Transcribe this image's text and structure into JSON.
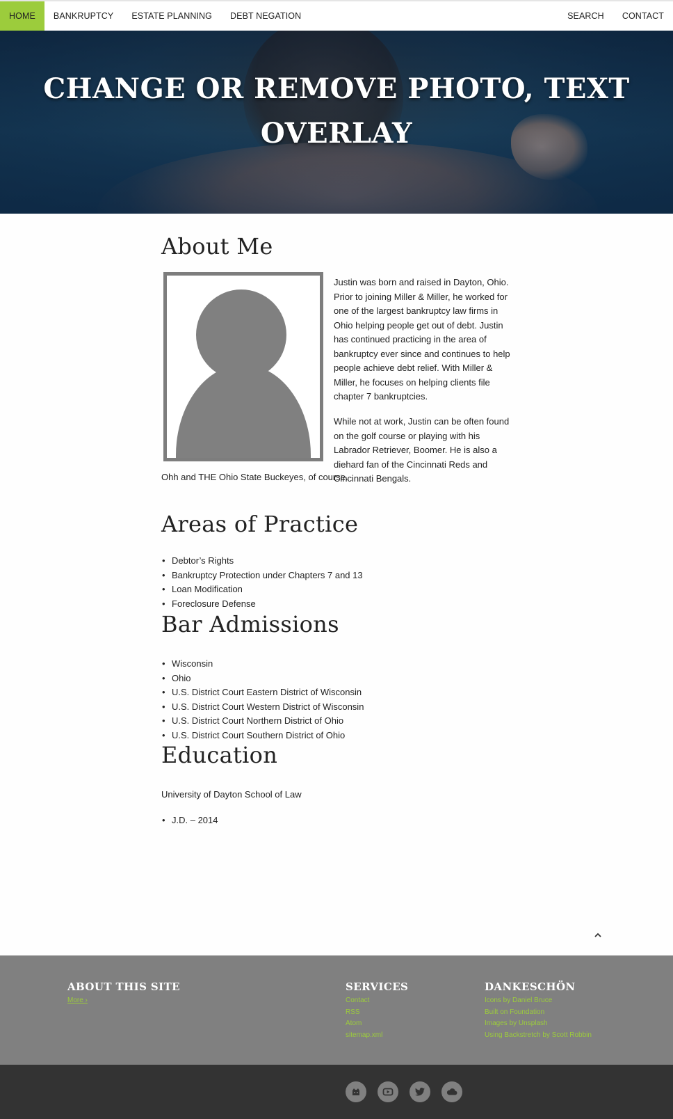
{
  "nav": {
    "left": [
      {
        "label": "HOME",
        "active": true
      },
      {
        "label": "BANKRUPTCY",
        "active": false
      },
      {
        "label": "ESTATE PLANNING",
        "active": false
      },
      {
        "label": "DEBT NEGATION",
        "active": false
      }
    ],
    "right": [
      {
        "label": "SEARCH"
      },
      {
        "label": "CONTACT"
      }
    ]
  },
  "hero": {
    "title": "CHANGE OR REMOVE PHOTO, TEXT OVERLAY"
  },
  "about": {
    "title": "About Me",
    "bio_paragraph_1": "Justin was born and raised in Dayton, Ohio. Prior to joining Miller & Miller, he worked for one of the largest bankruptcy law firms in Ohio helping people get out of debt. Justin has continued practicing in the area of bankruptcy ever since and continues to help people achieve debt relief. With Miller & Miller, he focuses on helping clients file chapter 7 bankruptcies.",
    "bio_paragraph_2": "While not at work, Justin can be often found on the golf course or playing with his Labrador Retriever, Boomer. He is also a diehard fan of the Cincinnati Reds and Cincinnati Bengals.",
    "bio_paragraph_2_tail": "Ohh and THE Ohio State Buckeyes, of course."
  },
  "areas": {
    "title": "Areas of Practice",
    "items": [
      "Debtor’s Rights",
      "Bankruptcy Protection under Chapters 7 and 13",
      "Loan Modification",
      "Foreclosure Defense"
    ]
  },
  "bar": {
    "title": "Bar Admissions",
    "items": [
      "Wisconsin",
      "Ohio",
      "U.S. District Court Eastern District of Wisconsin",
      "U.S. District Court Western District of Wisconsin",
      "U.S. District Court Northern District of Ohio",
      "U.S. District Court Southern District of Ohio"
    ]
  },
  "education": {
    "title": "Education",
    "school": "University of Dayton School of Law",
    "items": [
      "J.D. – 2014"
    ]
  },
  "back_to_top_icon": "chevron-up-icon",
  "footer": {
    "about": {
      "title": "ABOUT THIS SITE",
      "link": "More ›"
    },
    "services": {
      "title": "SERVICES",
      "links": [
        "Contact",
        "RSS",
        "Atom",
        "sitemap.xml"
      ]
    },
    "thanks": {
      "title": "DANKESCHÖN",
      "links": [
        "Icons by Daniel Bruce",
        "Built on Foundation",
        "Images by Unsplash",
        "Using Backstretch by Scott Robbin"
      ]
    },
    "link_color": "#9ccc3c"
  },
  "social_icons": [
    "github-icon",
    "youtube-icon",
    "twitter-icon",
    "cloud-icon"
  ],
  "colors": {
    "accent": "#9ccc3c",
    "footer_bg": "#808080",
    "bottom_bg": "#333333"
  }
}
